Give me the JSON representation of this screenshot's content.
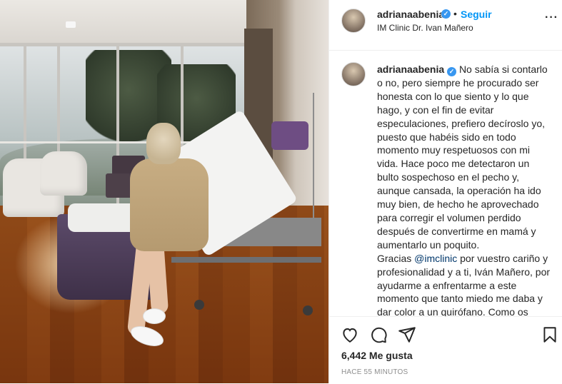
{
  "header": {
    "username": "adrianaabenia",
    "separator": "•",
    "follow_label": "Seguir",
    "location": "IM Clinic Dr. Ivan Mañero",
    "more_icon": "more-options-icon"
  },
  "caption": {
    "username": "adrianaabenia",
    "text_1": "No sabía si contarlo o no, pero siempre he procurado ser honesta con lo que siento y lo que hago, y con el fin de evitar especulaciones, prefiero decíroslo yo, puesto que habéis sido en todo momento muy respetuosos con mi vida. Hace poco me detectaron un bulto sospechoso en el pecho y, aunque cansada, la operación ha ido muy bien, de hecho he aprovechado para corregir el volumen perdido después de convertirme en mamá y aumentarlo un poquito.",
    "text_2_before": "Gracias",
    "mention": "@imclinic",
    "text_2_after": "por vuestro cariño y profesionalidad y a ti, Iván Mañero, por ayudarme a enfrentarme a este momento que tanto miedo me daba y dar color a un quirófano. Como os decía hace unos días, la mejor lucha es"
  },
  "actions": {
    "like_icon": "heart-icon",
    "comment_icon": "comment-icon",
    "share_icon": "share-icon",
    "save_icon": "bookmark-icon"
  },
  "likes_text": "6,442 Me gusta",
  "timestamp": "HACE 55 MINUTOS",
  "colors": {
    "link": "#0095f6",
    "verified": "#3897f0",
    "text": "#262626",
    "muted": "#8e8e8e"
  }
}
